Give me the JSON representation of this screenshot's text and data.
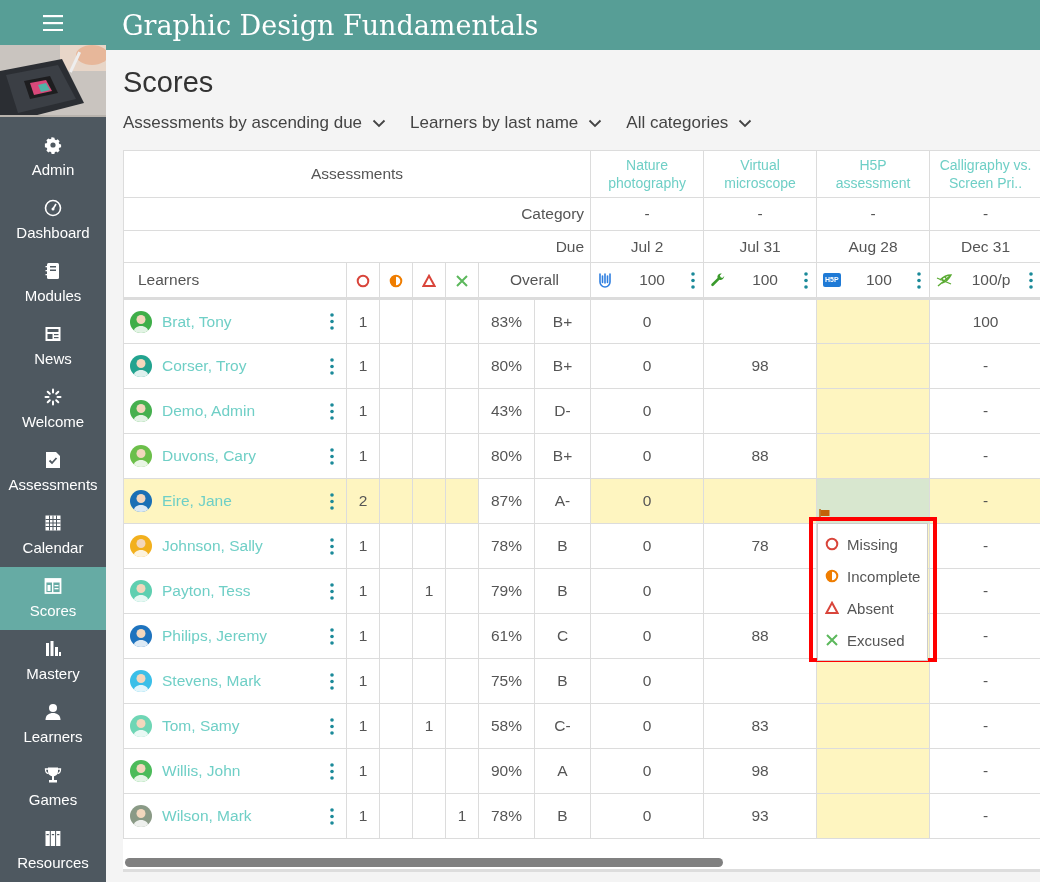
{
  "app": {
    "title": "Graphic Design Fundamentals"
  },
  "sidebar": {
    "items": [
      {
        "label": "Admin",
        "kind": "gear",
        "selected": false
      },
      {
        "label": "Dashboard",
        "kind": "gauge",
        "selected": false
      },
      {
        "label": "Modules",
        "kind": "notebook",
        "selected": false
      },
      {
        "label": "News",
        "kind": "newspaper",
        "selected": false
      },
      {
        "label": "Welcome",
        "kind": "spinner",
        "selected": false
      },
      {
        "label": "Assessments",
        "kind": "checklist",
        "selected": false
      },
      {
        "label": "Calendar",
        "kind": "calendar",
        "selected": false
      },
      {
        "label": "Scores",
        "kind": "table",
        "selected": true
      },
      {
        "label": "Mastery",
        "kind": "bars",
        "selected": false
      },
      {
        "label": "Learners",
        "kind": "person",
        "selected": false
      },
      {
        "label": "Games",
        "kind": "trophy",
        "selected": false
      },
      {
        "label": "Resources",
        "kind": "books",
        "selected": false
      }
    ]
  },
  "page": {
    "title": "Scores"
  },
  "filters": [
    {
      "label": "Assessments by ascending due"
    },
    {
      "label": "Learners by last name"
    },
    {
      "label": "All categories"
    }
  ],
  "table": {
    "header_label": "Assessments",
    "category_label": "Category",
    "due_label": "Due",
    "learners_label": "Learners",
    "overall_label": "Overall",
    "status_columns": [
      {
        "kind": "missing"
      },
      {
        "kind": "incomplete"
      },
      {
        "kind": "absent"
      },
      {
        "kind": "excused"
      }
    ],
    "assessments": [
      {
        "title": "Nature photography",
        "category": "-",
        "due": "Jul 2",
        "kind": "attachment",
        "points": "100",
        "selected": false
      },
      {
        "title": "Virtual microscope",
        "category": "-",
        "due": "Jul 31",
        "kind": "tool",
        "points": "100",
        "selected": false
      },
      {
        "title": "H5P assessment",
        "category": "-",
        "due": "Aug 28",
        "kind": "h5p",
        "badge": "H5P",
        "points": "100",
        "selected": true
      },
      {
        "title": "Calligraphy vs. Screen Pri..",
        "category": "-",
        "due": "Dec 31",
        "kind": "quill",
        "points": "100/p",
        "selected": false
      }
    ],
    "rows": [
      {
        "name": "Brat, Tony",
        "color": "#3fae49",
        "selected": false,
        "statuses": {
          "missing": "1"
        },
        "percent": "83%",
        "grade": "B+",
        "scores": {
          "column_1": "0",
          "column_4": "100"
        }
      },
      {
        "name": "Corser, Troy",
        "color": "#22a38f",
        "selected": false,
        "statuses": {
          "missing": "1"
        },
        "percent": "80%",
        "grade": "B+",
        "scores": {
          "column_1": "0",
          "column_2": "98",
          "column_4": "-"
        }
      },
      {
        "name": "Demo, Admin",
        "color": "#46b04f",
        "selected": false,
        "statuses": {
          "missing": "1"
        },
        "percent": "43%",
        "grade": "D-",
        "scores": {
          "column_1": "0",
          "column_4": "-"
        }
      },
      {
        "name": "Duvons, Cary",
        "color": "#6cbf4a",
        "selected": false,
        "statuses": {
          "missing": "1"
        },
        "percent": "80%",
        "grade": "B+",
        "scores": {
          "column_1": "0",
          "column_2": "88",
          "column_4": "-"
        }
      },
      {
        "name": "Eire, Jane",
        "color": "#1a6fb5",
        "selected": true,
        "statuses": {
          "missing": "2"
        },
        "percent": "87%",
        "grade": "A-",
        "scores": {
          "column_1": "0",
          "column_4": "-"
        }
      },
      {
        "name": "Johnson, Sally",
        "color": "#f2b01e",
        "selected": false,
        "statuses": {
          "missing": "1"
        },
        "percent": "78%",
        "grade": "B",
        "scores": {
          "column_1": "0",
          "column_2": "78",
          "column_4": "-"
        }
      },
      {
        "name": "Payton, Tess",
        "color": "#5fcfb0",
        "selected": false,
        "statuses": {
          "missing": "1",
          "absent": "1"
        },
        "percent": "79%",
        "grade": "B",
        "scores": {
          "column_1": "0",
          "column_4": "-"
        }
      },
      {
        "name": "Philips, Jeremy",
        "color": "#1e73be",
        "selected": false,
        "statuses": {
          "missing": "1"
        },
        "percent": "61%",
        "grade": "C",
        "scores": {
          "column_1": "0",
          "column_2": "88",
          "column_4": "-"
        }
      },
      {
        "name": "Stevens, Mark",
        "color": "#3bbfe8",
        "selected": false,
        "statuses": {
          "missing": "1"
        },
        "percent": "75%",
        "grade": "B",
        "scores": {
          "column_1": "0",
          "column_4": "-"
        }
      },
      {
        "name": "Tom, Samy",
        "color": "#6fd6b5",
        "selected": false,
        "statuses": {
          "missing": "1",
          "absent": "1"
        },
        "percent": "58%",
        "grade": "C-",
        "scores": {
          "column_1": "0",
          "column_2": "83",
          "column_4": "-"
        }
      },
      {
        "name": "Willis, John",
        "color": "#4cbb5a",
        "selected": false,
        "statuses": {
          "missing": "1"
        },
        "percent": "90%",
        "grade": "A",
        "scores": {
          "column_1": "0",
          "column_2": "98",
          "column_4": "-"
        }
      },
      {
        "name": "Wilson, Mark",
        "color": "#8a9a86",
        "selected": false,
        "statuses": {
          "missing": "1",
          "excused": "1"
        },
        "percent": "78%",
        "grade": "B",
        "scores": {
          "column_1": "0",
          "column_2": "93",
          "column_4": "-"
        }
      }
    ]
  },
  "status_menu": {
    "outlined": true,
    "items": [
      {
        "kind": "missing",
        "label": "Missing"
      },
      {
        "kind": "incomplete",
        "label": "Incomplete"
      },
      {
        "kind": "absent",
        "label": "Absent"
      },
      {
        "kind": "excused",
        "label": "Excused"
      }
    ]
  }
}
